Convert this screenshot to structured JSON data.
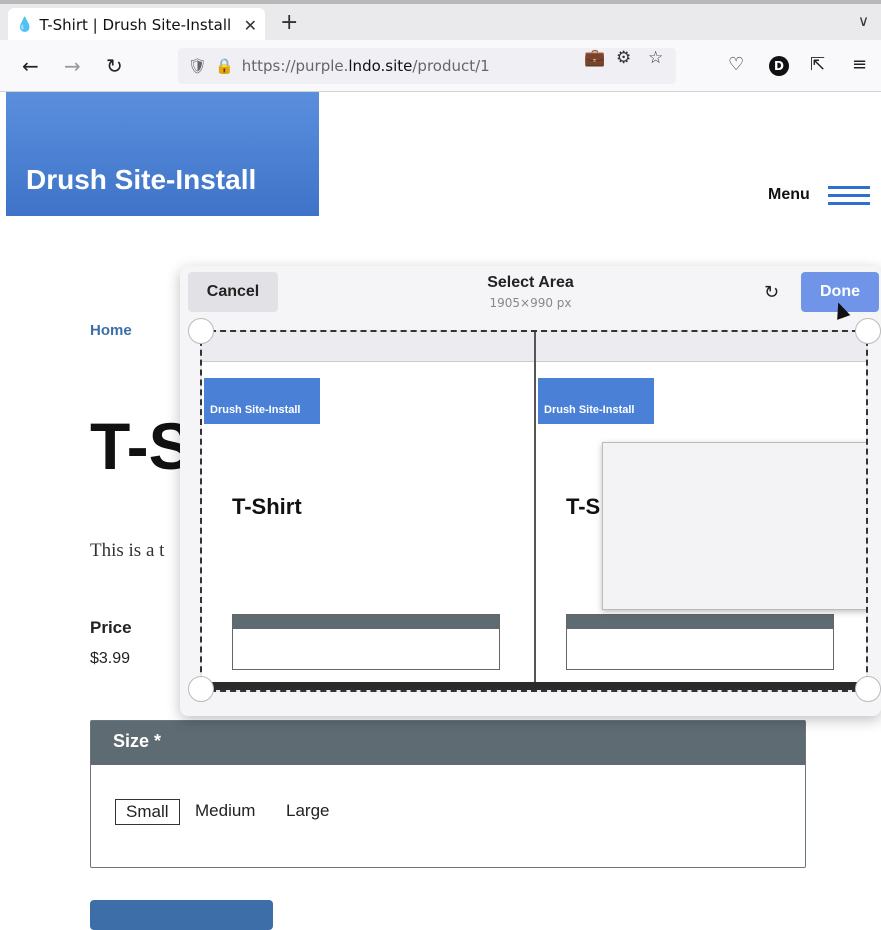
{
  "browser": {
    "tab_title": "T-Shirt | Drush Site-Install",
    "url_prefix": "https://purple.",
    "url_domain": "lndo.site",
    "url_path": "/product/1",
    "profile_initial": "D"
  },
  "site": {
    "branding": "Drush Site-Install",
    "menu_label": "Menu"
  },
  "page": {
    "breadcrumb_home": "Home",
    "title": "T-Shirt",
    "description": "This is a t",
    "price_label": "Price",
    "price_value": "$3.99",
    "size_label": "Size *",
    "size_options": [
      "Small",
      "Medium",
      "Large"
    ]
  },
  "overlay": {
    "cancel_label": "Cancel",
    "title": "Select Area",
    "dimensions": "1905×990 px",
    "done_label": "Done"
  },
  "preview": {
    "branding": "Drush Site-Install",
    "title_left": "T-Shirt",
    "title_right": "T-S"
  }
}
